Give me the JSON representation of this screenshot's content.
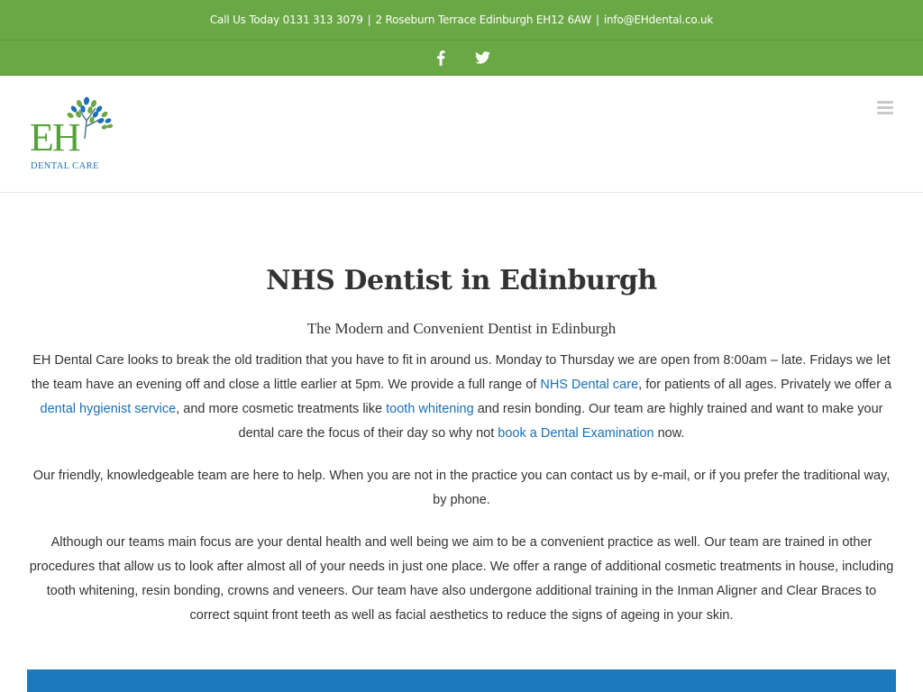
{
  "topbar": {
    "call_text": "Call Us Today 0131 313 3079",
    "address": "2 Roseburn Terrace Edinburgh EH12 6AW",
    "separator": "|",
    "email": "info@EHdental.co.uk"
  },
  "social": {
    "facebook_icon": "facebook-icon",
    "twitter_icon": "twitter-icon"
  },
  "logo": {
    "main": "EH",
    "sub": "DENTAL CARE"
  },
  "menu_icon": "hamburger-menu-icon",
  "main": {
    "title": "NHS Dentist in Edinburgh",
    "subtitle": "The Modern and Convenient Dentist in Edinburgh",
    "p1": {
      "t1": "EH Dental Care looks to break the old tradition that you have to fit in around us. Monday to Thursday we are open from  8:00am – late. Fridays we let the team have an evening off and close a little earlier at 5pm.   We  provide a full range of  ",
      "link1": "NHS Dental care",
      "t2": ", for patients of all ages. Privately we offer a   ",
      "link2": "dental hygienist service",
      "t3": ", and more cosmetic  treatments like ",
      "link3": "tooth whitening",
      "t4": " and resin bonding. Our team are highly trained and want to make your dental  care the focus of their day so why not ",
      "link4": "book a Dental Examination",
      "t5": " now."
    },
    "p2": "Our friendly, knowledgeable team  are here to help. When you are not in the practice you can contact us by e-mail, or if you prefer the traditional way, by phone.",
    "p3": "Although our  teams main focus are your dental health and well being we  aim to  be a convenient practice as well.  Our team are  trained in other  procedures that allow us to look after almost all of your needs in just one place.  We  offer a range of additional cosmetic treatments in house, including tooth whitening, resin bonding, crowns and veneers. Our team have also undergone additional training in the Inman Aligner and Clear Braces  to correct squint front teeth as well as facial aesthetics to reduce the signs of ageing in your skin."
  },
  "colors": {
    "green": "#6aa745",
    "link_blue": "#1a6fb7",
    "section_blue": "#1c78bf"
  }
}
